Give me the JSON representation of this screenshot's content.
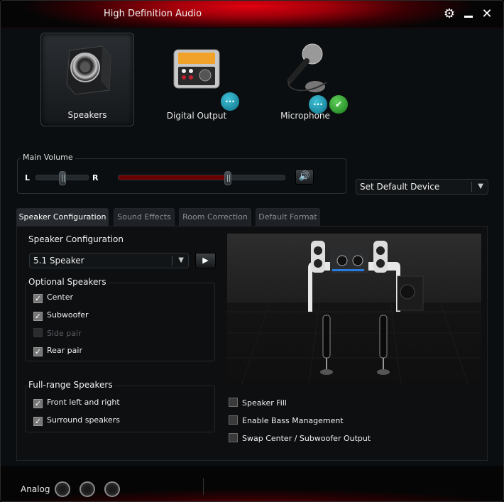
{
  "window": {
    "title": "High Definition Audio"
  },
  "titlebar": {
    "settings_icon": "gear-icon",
    "minimize_icon": "minimize-icon",
    "close_icon": "close-icon",
    "gear_glyph": "⚙",
    "close_glyph": "✕"
  },
  "devices": [
    {
      "label": "Speakers",
      "icon": "speaker-icon",
      "active": true,
      "badges": []
    },
    {
      "label": "Digital Output",
      "icon": "digital-output-icon",
      "active": false,
      "badges": [
        "chat"
      ]
    },
    {
      "label": "Microphone",
      "icon": "microphone-icon",
      "active": false,
      "badges": [
        "chat",
        "ok"
      ]
    }
  ],
  "badge_glyphs": {
    "chat": "···",
    "ok": "✔"
  },
  "main_volume": {
    "label": "Main Volume",
    "balance_left": "L",
    "balance_right": "R",
    "balance_value": 0.5,
    "volume_value": 0.66,
    "mute_glyph": "🔊",
    "fill_color": "#6b0000"
  },
  "default_device": {
    "value": "Set Default Device",
    "arrow": "▼"
  },
  "tabs": [
    {
      "label": "Speaker Configuration",
      "active": true
    },
    {
      "label": "Sound Effects",
      "active": false
    },
    {
      "label": "Room Correction",
      "active": false
    },
    {
      "label": "Default Format",
      "active": false
    }
  ],
  "speaker_config": {
    "heading": "Speaker Configuration",
    "selected": "5.1 Speaker",
    "arrow": "▼",
    "play_glyph": "▶",
    "optional_heading": "Optional Speakers",
    "optional": [
      {
        "label": "Center",
        "checked": true,
        "disabled": false
      },
      {
        "label": "Subwoofer",
        "checked": true,
        "disabled": false
      },
      {
        "label": "Side pair",
        "checked": false,
        "disabled": true
      },
      {
        "label": "Rear pair",
        "checked": true,
        "disabled": false
      }
    ],
    "fullrange_heading": "Full-range Speakers",
    "fullrange": [
      {
        "label": "Front left and right",
        "checked": true
      },
      {
        "label": "Surround speakers",
        "checked": true
      }
    ],
    "extra_options": [
      {
        "label": "Speaker Fill",
        "checked": false
      },
      {
        "label": "Enable Bass Management",
        "checked": false
      },
      {
        "label": "Swap Center / Subwoofer Output",
        "checked": false
      }
    ]
  },
  "footer": {
    "analog_label": "Analog",
    "jacks": 3
  },
  "colors": {
    "accent": "#e00010",
    "background": "#0b0e10",
    "badge_chat": "#1a9ab3",
    "badge_ok": "#2aa52a"
  }
}
